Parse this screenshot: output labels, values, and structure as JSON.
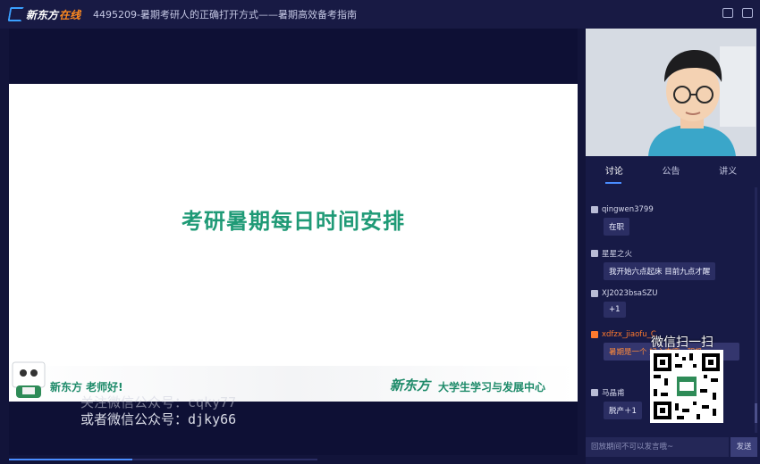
{
  "app": {
    "logo_text": "新东方",
    "logo_online": "在线",
    "title": "4495209-暑期考研人的正确打开方式——暑期高效备考指南"
  },
  "slide": {
    "title": "考研暑期每日时间安排",
    "footer_greeting": "新东方 老师好!",
    "footer_brand": "新东方",
    "footer_brand_sub": "大学生学习与发展中心"
  },
  "overlay": {
    "line1": "关注微信公众号：cqky77",
    "line2": "或者微信公众号：djky66"
  },
  "playback": {
    "progress_fraction": 0.4
  },
  "panel": {
    "tabs": [
      {
        "label": "讨论",
        "active": true
      },
      {
        "label": "公告",
        "active": false
      },
      {
        "label": "讲义",
        "active": false
      }
    ],
    "messages": [
      {
        "user": "qingwen3799",
        "text": "在职",
        "highlight": false
      },
      {
        "user": "星星之火",
        "text": "我开始六点起床 目前九点才醒",
        "highlight": false
      },
      {
        "user": "XJ2023bsaSZU",
        "text": "+1",
        "highlight": false
      },
      {
        "user": "xdfzx_jiaofu_C",
        "text": "暑期是一个                      好心态哦，积极",
        "highlight": true
      },
      {
        "user": "马晶甫",
        "text": "脱产＋1",
        "highlight": false
      }
    ],
    "input_placeholder": "回放期间不可以发言哦~",
    "send_label": "发送"
  },
  "qr": {
    "title": "微信扫一扫"
  },
  "colors": {
    "accent": "#4a8dff",
    "slide_green": "#1f9a76",
    "orange": "#ff7a2e"
  }
}
